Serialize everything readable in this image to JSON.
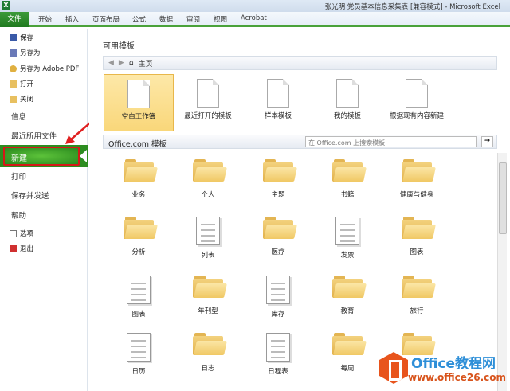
{
  "window": {
    "title": "张光明 党员基本信息采集表 [兼容模式] - Microsoft Excel"
  },
  "ribbon": {
    "tabs": [
      "文件",
      "开始",
      "插入",
      "页面布局",
      "公式",
      "数据",
      "审阅",
      "视图",
      "Acrobat"
    ]
  },
  "left": {
    "small_top": [
      "保存",
      "另存为",
      "另存为 Adobe PDF",
      "打开",
      "关闭"
    ],
    "sections": [
      "信息",
      "最近所用文件"
    ],
    "active": "新建",
    "sections2": [
      "打印",
      "保存并发送",
      "帮助"
    ],
    "small_bottom": [
      "选项",
      "退出"
    ]
  },
  "main": {
    "heading": "可用模板",
    "nav": {
      "back": "◀",
      "forward": "▶",
      "home": "主页"
    },
    "top_templates": [
      "空白工作簿",
      "最近打开的模板",
      "样本模板",
      "我的模板",
      "根据现有内容新建"
    ],
    "office_label": "Office.com 模板",
    "search_placeholder": "在 Office.com 上搜索模板",
    "search_go": "➜",
    "grid": [
      [
        "业务",
        "个人",
        "主题",
        "书籍",
        "健康与健身"
      ],
      [
        "分析",
        "列表",
        "医疗",
        "发票",
        "图表"
      ],
      [
        "图表",
        "年刊型",
        "库存",
        "教育",
        "旅行"
      ],
      [
        "日历",
        "日志",
        "日程表",
        "每周",
        ""
      ]
    ]
  },
  "watermark": {
    "name": "Office教程网",
    "url": "www.office26.com"
  }
}
